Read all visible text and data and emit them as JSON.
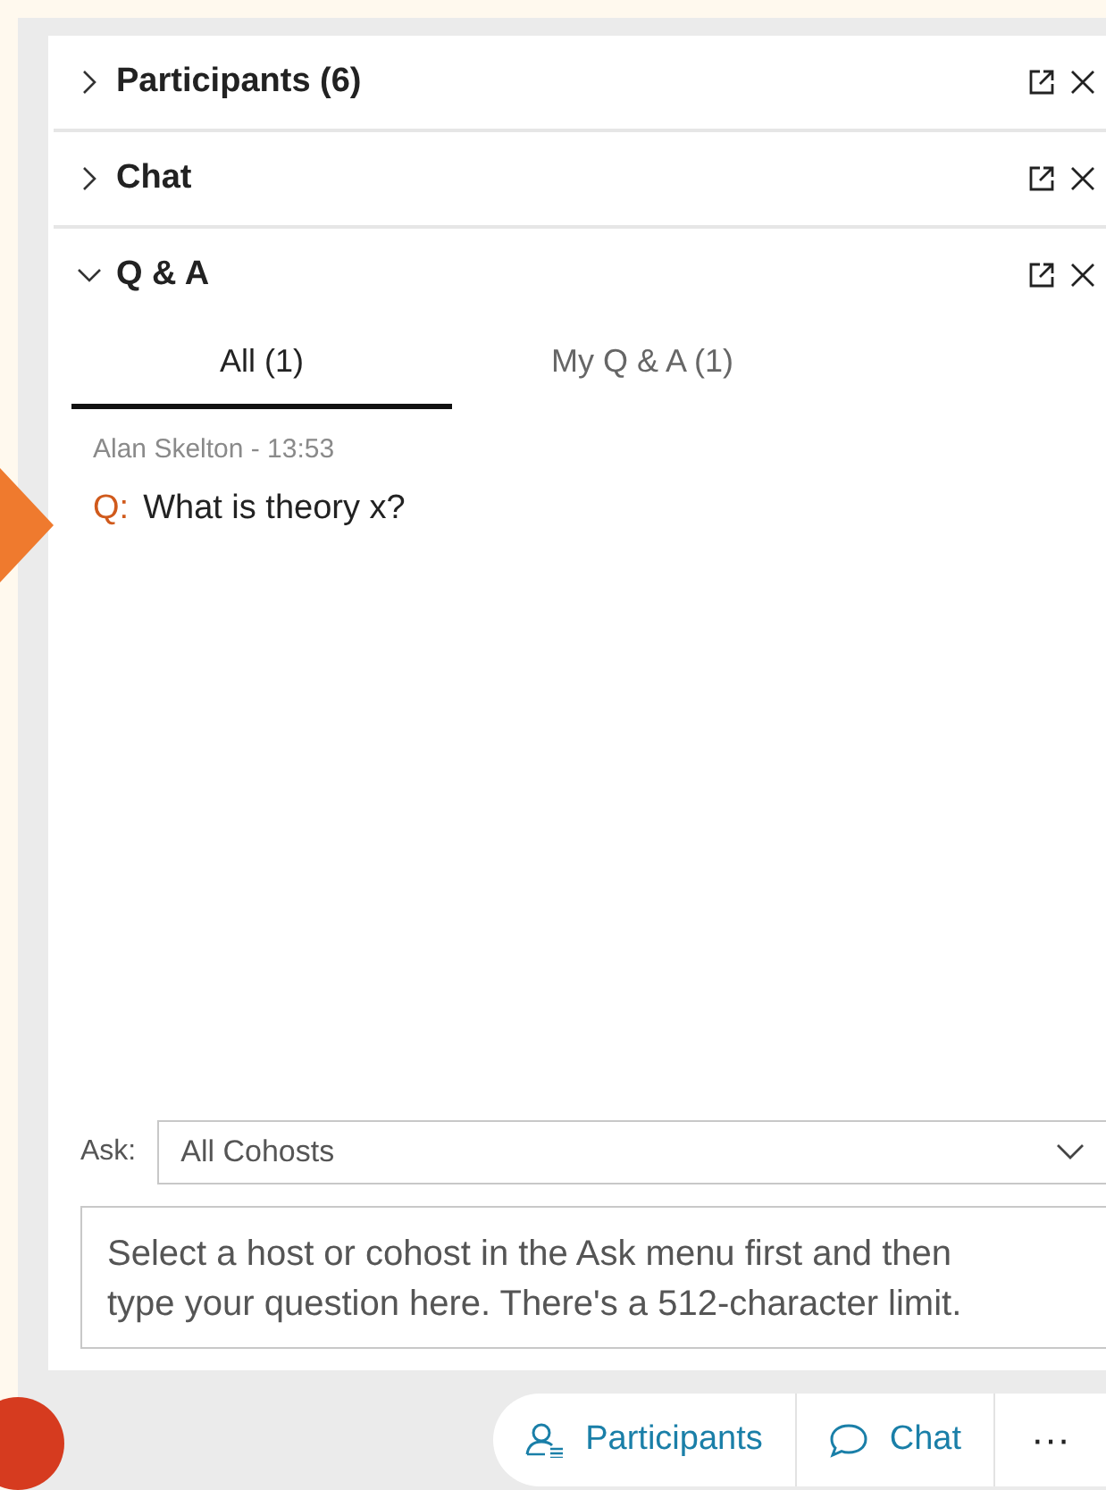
{
  "panels": [
    {
      "title": "Participants (6)",
      "expanded": false
    },
    {
      "title": "Chat",
      "expanded": false
    },
    {
      "title": "Q & A",
      "expanded": true
    }
  ],
  "tabs": [
    {
      "label": "All (1)",
      "selected": true
    },
    {
      "label": "My Q & A (1)",
      "selected": false
    }
  ],
  "questions": [
    {
      "author": "Alan Skelton - 13:53",
      "prefix": "Q:",
      "text": "What is theory x?"
    }
  ],
  "ask": {
    "label": "Ask:",
    "value": "All Cohosts"
  },
  "question_box": {
    "placeholder": "Select a host or cohost in the Ask menu first and then type your question here. There's a 512-character limit."
  },
  "toolbar": [
    {
      "kind": "participants",
      "label": "Participants"
    },
    {
      "kind": "chat",
      "label": "Chat"
    },
    {
      "kind": "more",
      "label": "···"
    }
  ]
}
